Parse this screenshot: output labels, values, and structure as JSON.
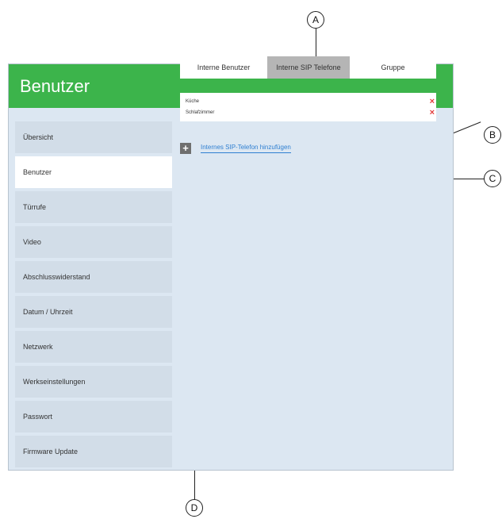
{
  "header": {
    "title": "Benutzer"
  },
  "sidebar": {
    "items": [
      {
        "label": "Übersicht"
      },
      {
        "label": "Benutzer"
      },
      {
        "label": "Türrufe"
      },
      {
        "label": "Video"
      },
      {
        "label": "Abschlusswiderstand"
      },
      {
        "label": "Datum / Uhrzeit"
      },
      {
        "label": "Netzwerk"
      },
      {
        "label": "Werkseinstellungen"
      },
      {
        "label": "Passwort"
      },
      {
        "label": "Firmware Update"
      }
    ],
    "active_index": 1
  },
  "tabs": [
    {
      "label": "Interne Benutzer"
    },
    {
      "label": "Interne SIP Telefone"
    },
    {
      "label": "Gruppe"
    }
  ],
  "active_tab_index": 1,
  "list": {
    "items": [
      {
        "name": "Küche",
        "delete_label": "×"
      },
      {
        "name": "Schlafzimmer",
        "delete_label": "×"
      }
    ]
  },
  "add": {
    "icon": "plus-icon",
    "label": "Internes SIP-Telefon hinzufügen"
  },
  "callouts": {
    "a": "A",
    "b": "B",
    "c": "C",
    "d": "D"
  },
  "colors": {
    "header_green": "#3cb44b",
    "delete_red": "#e23b3b",
    "link_blue": "#2f7fd1",
    "active_tab_gray": "#b5b5b5",
    "panel_blue": "#dce7f2"
  }
}
